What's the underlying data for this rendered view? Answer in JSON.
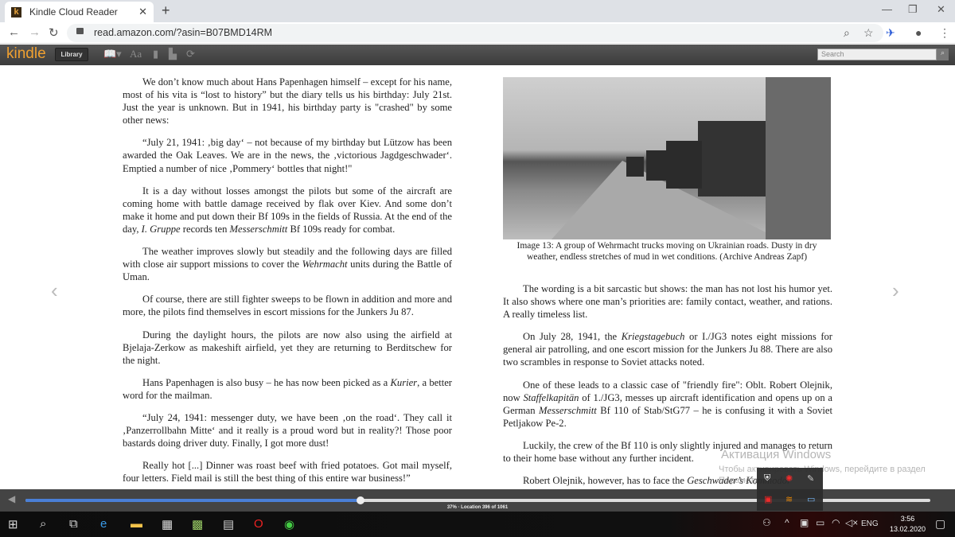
{
  "browser": {
    "tab_title": "Kindle Cloud Reader",
    "url": "read.amazon.com/?asin=B07BMD14RM"
  },
  "kindle": {
    "logo": "kindle",
    "library_label": "Library",
    "search_placeholder": "Search"
  },
  "left_paragraphs": [
    "We don’t know much about Hans Papenhagen himself – except for his name, most of his vita is “lost to history” but the diary tells us his birthday: July 21st. Just the year is unknown. But in 1941, his birthday party is \"crashed\" by some other news:",
    "“July 21, 1941: ‚big day‘ – not because of my birthday but Lützow has been awarded the Oak Leaves. We are in the news, the ‚victorious Jagdgeschwader‘. Emptied a number of nice ‚Pommery‘ bottles that night!\"",
    "It is a day without losses amongst the pilots but some of the aircraft are coming home with battle damage received by flak over Kiev. And some don’t make it home and put down their Bf 109s in the fields of Russia. At the end of the day, <i>I. Gruppe</i> records ten <i>Messerschmitt</i> Bf 109s ready for combat.",
    "The weather improves slowly but steadily and the following days are filled with close air support missions to cover the <i>Wehrmacht</i> units during the Battle of Uman.",
    "Of course, there are still fighter sweeps to be flown in addition and more and more, the pilots find themselves in escort missions for the Junkers Ju 87.",
    "During the daylight hours, the pilots are now also using the airfield at Bjelaja-Zerkow as makeshift airfield, yet they are returning to Berditschew for the night.",
    "Hans Papenhagen is also busy – he has now been picked as a <i>Kurier</i>, a better word for the mailman.",
    "“July 24, 1941: messenger duty, we have been ‚on the road‘. They call it ‚Panzerrollbahn Mitte‘ and it really is a proud word but in reality?! Those poor bastards doing driver duty. Finally, I got more dust!",
    "Really hot [...] Dinner was roast beef with fried potatoes. Got mail myself, four letters. Field mail is still the best thing of this entire war business!”"
  ],
  "image_caption": "Image 13: A group of Wehrmacht trucks moving on Ukrainian roads. Dusty in dry weather, endless stretches of mud in wet conditions. (Archive Andreas Zapf)",
  "right_paragraphs": [
    "The wording is a bit sarcastic but shows: the man has not lost his humor yet. It also shows where one man’s priorities are: family contact, weather, and rations. A really timeless list.",
    "On July 28, 1941, the <i>Kriegstagebuch</i> or I./JG3 notes eight missions for general air patrolling, and one escort mission for the Junkers Ju 88. There are also two scrambles in response to Soviet attacks noted.",
    "One of these leads to a classic case of \"friendly fire\": Oblt. Robert Olejnik, now <i>Staffelkapitän</i> of 1./JG3, messes up aircraft identification and opens up on a German <i>Messerschmitt</i> Bf 110 of Stab/StG77 – he is confusing it with a Soviet Petljakow Pe-2.",
    "Luckily, the crew of the Bf 110 is only slightly injured and manages to return to their home base without any further incident.",
    "Robert Olejnik, however, has to face the <i>Geschwader’s Kommodor</i>"
  ],
  "progress": {
    "label": "37% · Location 396 of 1061",
    "percent": 37
  },
  "watermark": {
    "title": "Активация Windows",
    "subtitle": "Чтобы активировать Windows, перейдите в раздел",
    "subtitle2": "Параметры."
  },
  "taskbar": {
    "language": "ENG",
    "time": "3:56",
    "date": "13.02.2020"
  }
}
